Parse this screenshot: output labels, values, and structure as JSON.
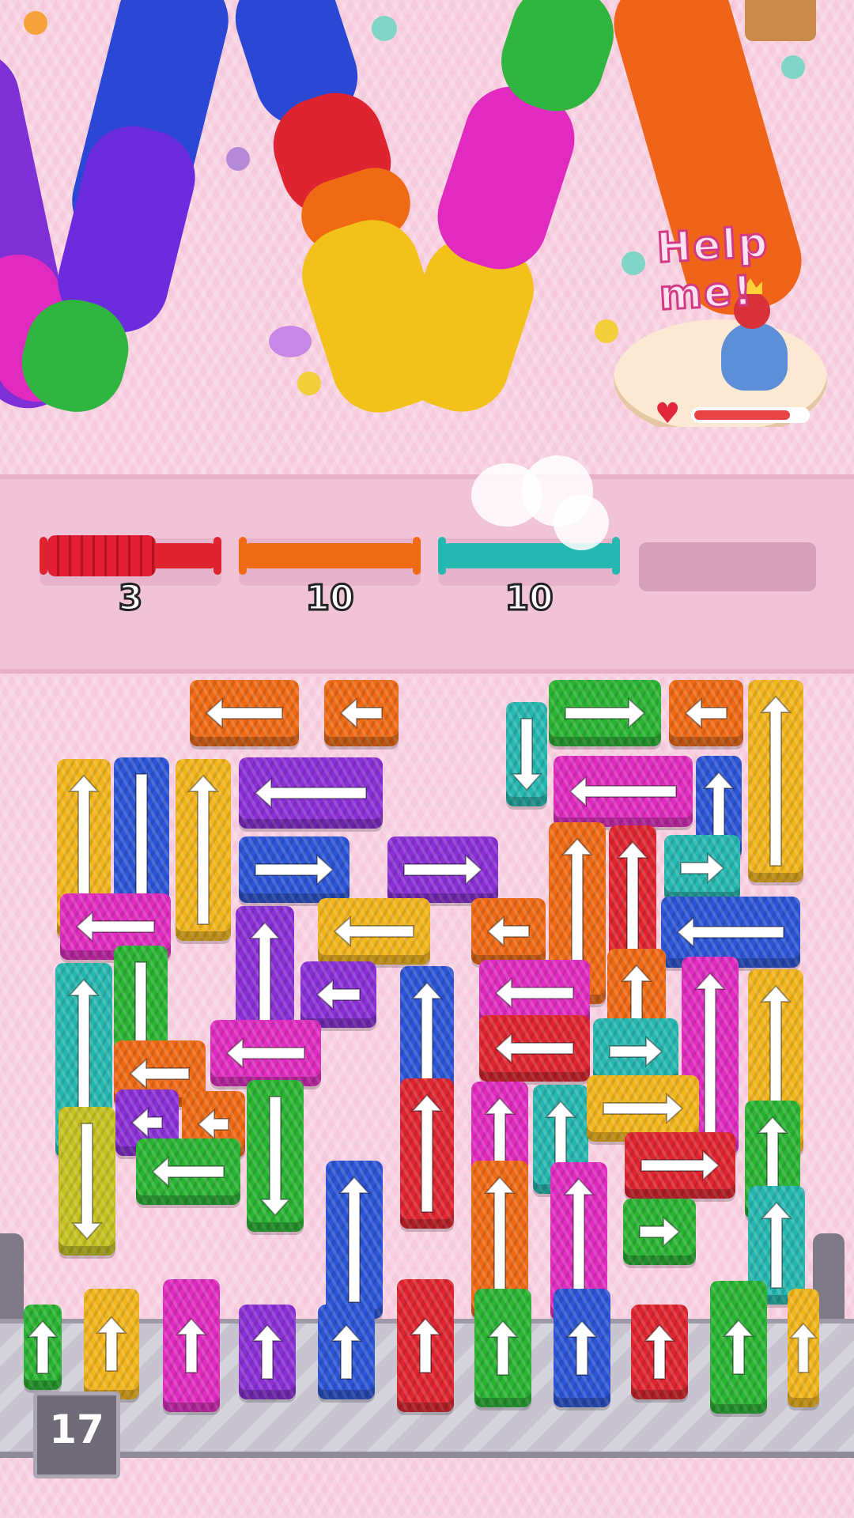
{
  "title_bubble": "Help me!",
  "colors": {
    "red": "#e0242f",
    "orange": "#f06a14",
    "yellow": "#f2b51b",
    "green": "#29b432",
    "blue": "#2b55d6",
    "purple": "#8a2fd6",
    "pink": "#e12bc0",
    "teal": "#25b8b0",
    "olive": "#c7c21f"
  },
  "hud": {
    "health": {
      "icon": "heart-icon",
      "value": 0.85
    }
  },
  "collector": {
    "slots": [
      {
        "color": "red",
        "count": "3",
        "fill": 0.65
      },
      {
        "color": "orange",
        "count": "10",
        "fill": 0
      },
      {
        "color": "teal",
        "count": "10",
        "fill": 0
      },
      {
        "color": "empty",
        "count": ""
      }
    ]
  },
  "board": {
    "blocks": [
      {
        "color": "orange",
        "dir": "left"
      },
      {
        "color": "orange",
        "dir": "left"
      },
      {
        "color": "teal",
        "dir": "down"
      },
      {
        "color": "green",
        "dir": "right"
      },
      {
        "color": "orange",
        "dir": "left"
      },
      {
        "color": "yellow",
        "dir": "up"
      },
      {
        "color": "yellow",
        "dir": "up"
      },
      {
        "color": "blue",
        "dir": "down"
      },
      {
        "color": "yellow",
        "dir": "up"
      },
      {
        "color": "purple",
        "dir": "left"
      },
      {
        "color": "pink",
        "dir": "left"
      },
      {
        "color": "blue",
        "dir": "up"
      },
      {
        "color": "blue",
        "dir": "right"
      },
      {
        "color": "purple",
        "dir": "right"
      },
      {
        "color": "orange",
        "dir": "up"
      },
      {
        "color": "red",
        "dir": "up"
      },
      {
        "color": "teal",
        "dir": "right"
      },
      {
        "color": "pink",
        "dir": "left"
      },
      {
        "color": "purple",
        "dir": "up"
      },
      {
        "color": "yellow",
        "dir": "left"
      },
      {
        "color": "orange",
        "dir": "left"
      },
      {
        "color": "blue",
        "dir": "left"
      },
      {
        "color": "green",
        "dir": "down"
      },
      {
        "color": "purple",
        "dir": "left"
      },
      {
        "color": "teal",
        "dir": "up"
      },
      {
        "color": "blue",
        "dir": "up"
      },
      {
        "color": "pink",
        "dir": "left"
      },
      {
        "color": "orange",
        "dir": "up"
      },
      {
        "color": "pink",
        "dir": "up"
      },
      {
        "color": "yellow",
        "dir": "up"
      },
      {
        "color": "pink",
        "dir": "left"
      },
      {
        "color": "red",
        "dir": "left"
      },
      {
        "color": "teal",
        "dir": "right"
      },
      {
        "color": "orange",
        "dir": "left"
      },
      {
        "color": "purple",
        "dir": "left"
      },
      {
        "color": "orange",
        "dir": "left"
      },
      {
        "color": "green",
        "dir": "down"
      },
      {
        "color": "red",
        "dir": "up"
      },
      {
        "color": "pink",
        "dir": "up"
      },
      {
        "color": "teal",
        "dir": "up"
      },
      {
        "color": "yellow",
        "dir": "right"
      },
      {
        "color": "olive",
        "dir": "down"
      },
      {
        "color": "green",
        "dir": "left"
      },
      {
        "color": "green",
        "dir": "up"
      },
      {
        "color": "red",
        "dir": "right"
      },
      {
        "color": "blue",
        "dir": "up"
      },
      {
        "color": "orange",
        "dir": "up"
      },
      {
        "color": "pink",
        "dir": "up"
      },
      {
        "color": "green",
        "dir": "right"
      },
      {
        "color": "teal",
        "dir": "up"
      }
    ]
  },
  "tray": {
    "blocks": [
      {
        "color": "green",
        "dir": "up"
      },
      {
        "color": "yellow",
        "dir": "up"
      },
      {
        "color": "pink",
        "dir": "up"
      },
      {
        "color": "purple",
        "dir": "up"
      },
      {
        "color": "blue",
        "dir": "up"
      },
      {
        "color": "red",
        "dir": "up"
      },
      {
        "color": "green",
        "dir": "up"
      },
      {
        "color": "blue",
        "dir": "up"
      },
      {
        "color": "red",
        "dir": "up"
      },
      {
        "color": "green",
        "dir": "up"
      },
      {
        "color": "yellow",
        "dir": "up"
      }
    ],
    "remaining": "17"
  }
}
